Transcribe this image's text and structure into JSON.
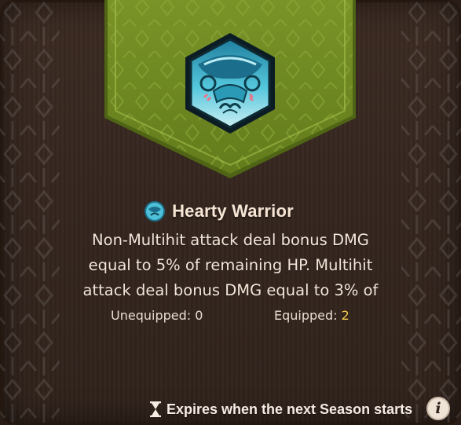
{
  "item": {
    "name": "Hearty Warrior",
    "icon": "mask-emblem-icon",
    "description_lines": [
      "Non-Multihit attack deal bonus DMG",
      "equal to 5% of remaining HP. Multihit",
      "attack deal bonus DMG equal to 3% of"
    ]
  },
  "stats": {
    "unequipped_label": "Unequipped:",
    "unequipped_value": "0",
    "equipped_label": "Equipped:",
    "equipped_value": "2"
  },
  "footer": {
    "icon": "hourglass-icon",
    "expires_text": "Expires when the next Season starts",
    "info_glyph": "i"
  },
  "colors": {
    "banner_green": "#6f8a22",
    "emblem_teal": "#3fb3cf",
    "equipped_accent": "#f2c94c",
    "background": "#33251e"
  }
}
